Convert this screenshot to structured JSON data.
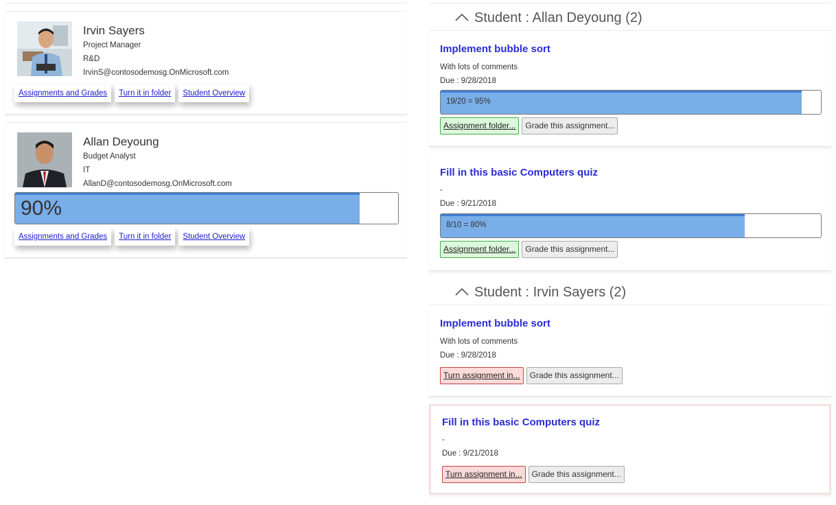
{
  "students": [
    {
      "name": "Irvin Sayers",
      "title": "Project Manager",
      "department": "R&D",
      "email": "IrvinS@contosodemosg.OnMicrosoft.com",
      "photo_icon": "person-photo",
      "links": [
        "Assignments and Grades",
        "Turn it in folder",
        "Student Overview"
      ]
    },
    {
      "name": "Allan Deyoung",
      "title": "Budget Analyst",
      "department": "IT",
      "email": "AllanD@contosodemosg.OnMicrosoft.com",
      "photo_icon": "person-photo",
      "grade_text": "90%",
      "grade_fraction": 0.9,
      "links": [
        "Assignments and Grades",
        "Turn it in folder",
        "Student Overview"
      ]
    }
  ],
  "groups": [
    {
      "title": "Student : Allan Deyoung (2)",
      "assignments": [
        {
          "title": "Implement bubble sort",
          "description": "With lots of comments",
          "due": "Due : 9/28/2018",
          "grade_text": "19/20 = 95%",
          "grade_fraction": 0.95,
          "folder_button": "Assignment folder...",
          "grade_button": "Grade this assignment..."
        },
        {
          "title": "Fill in this basic Computers quiz",
          "description": "-",
          "due": "Due : 9/21/2018",
          "grade_text": "8/10 = 80%",
          "grade_fraction": 0.8,
          "folder_button": "Assignment folder...",
          "grade_button": "Grade this assignment..."
        }
      ]
    },
    {
      "title": "Student : Irvin Sayers (2)",
      "assignments": [
        {
          "title": "Implement bubble sort",
          "description": "With lots of comments",
          "due": "Due : 9/28/2018",
          "turnin_button": "Turn assignment in...",
          "grade_button": "Grade this assignment..."
        },
        {
          "title": "Fill in this basic Computers quiz",
          "description": "-",
          "due": "Due : 9/21/2018",
          "turnin_button": "Turn assignment in...",
          "grade_button": "Grade this assignment..."
        }
      ]
    }
  ],
  "colors": {
    "progress_fill": "#79aee8",
    "progress_edge": "#3d7fd3",
    "link": "#1a1acc",
    "assignment_title": "#2b2bd6",
    "green_button": "#ddf7dd",
    "red_button": "#fbdada"
  }
}
